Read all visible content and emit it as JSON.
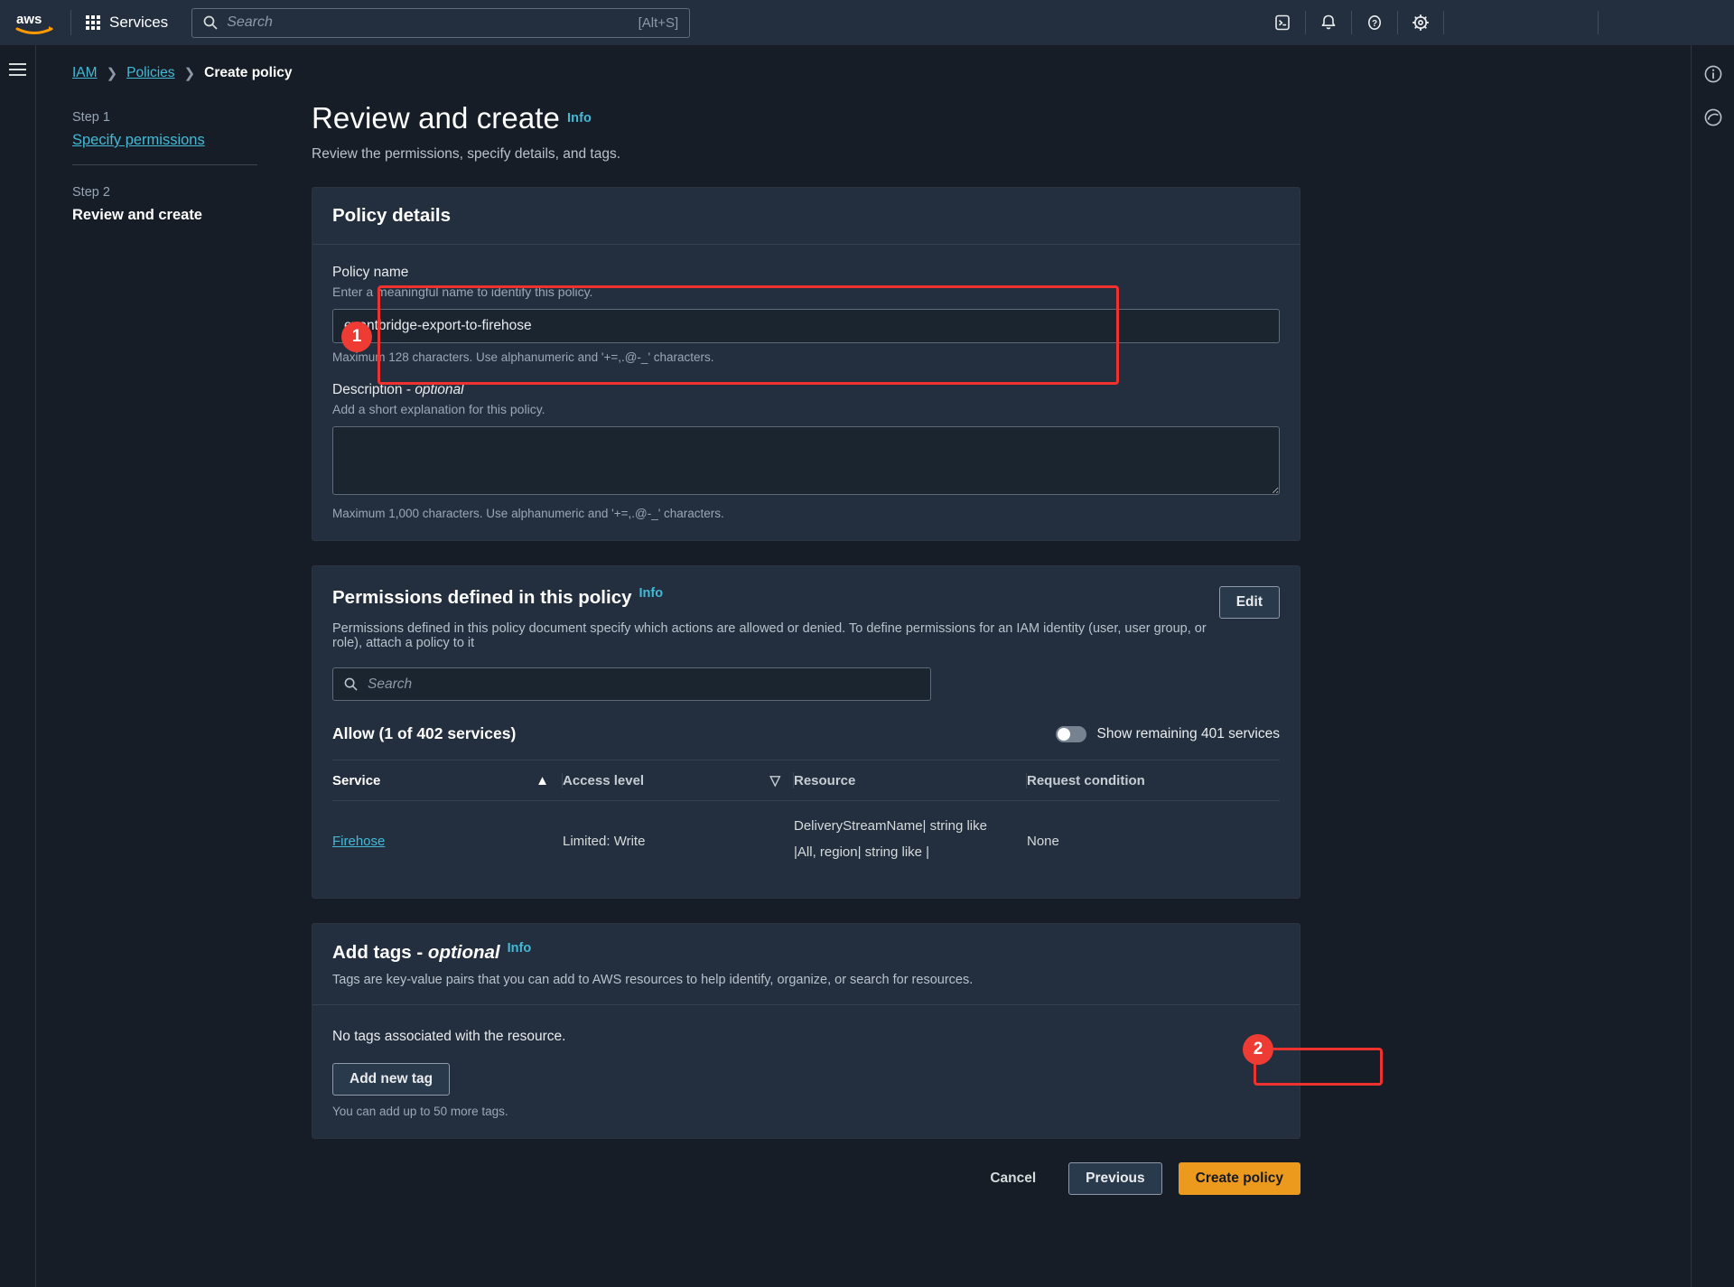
{
  "topnav": {
    "logo_alt": "aws",
    "services_label": "Services",
    "search_placeholder": "Search",
    "search_shortcut": "[Alt+S]",
    "icons": [
      "cloudshell-icon",
      "notifications-bell-icon",
      "help-circle-icon",
      "settings-gear-icon"
    ]
  },
  "breadcrumb": {
    "items": [
      "IAM",
      "Policies",
      "Create policy"
    ]
  },
  "steps": [
    {
      "number": "Step 1",
      "label": "Specify permissions",
      "current": false
    },
    {
      "number": "Step 2",
      "label": "Review and create",
      "current": true
    }
  ],
  "page": {
    "title": "Review and create",
    "info": "Info",
    "subtitle": "Review the permissions, specify details, and tags."
  },
  "policy_details": {
    "heading": "Policy details",
    "name_label": "Policy name",
    "name_desc": "Enter a meaningful name to identify this policy.",
    "name_value": "eventbridge-export-to-firehose",
    "name_hint": "Maximum 128 characters. Use alphanumeric and '+=,.@-_' characters.",
    "desc_label": "Description - ",
    "desc_label_em": "optional",
    "desc_desc": "Add a short explanation for this policy.",
    "desc_value": "",
    "desc_hint": "Maximum 1,000 characters. Use alphanumeric and '+=,.@-_' characters."
  },
  "permissions": {
    "heading": "Permissions defined in this policy",
    "info": "Info",
    "edit_label": "Edit",
    "description": "Permissions defined in this policy document specify which actions are allowed or denied. To define permissions for an IAM identity (user, user group, or role), attach a policy to it",
    "search_placeholder": "Search",
    "allow_title": "Allow (1 of 402 services)",
    "toggle_label": "Show remaining 401 services",
    "toggle_on": false,
    "columns": [
      "Service",
      "Access level",
      "Resource",
      "Request condition"
    ],
    "sort_column": "Service",
    "sort_glyph": "▲",
    "filter_glyph": "▽",
    "rows": [
      {
        "service": "Firehose",
        "access_level": "Limited: Write",
        "resource_line1": "DeliveryStreamName| string like",
        "resource_line2": "|All, region| string like |",
        "request_condition": "None"
      }
    ]
  },
  "tags": {
    "heading": "Add tags - ",
    "heading_em": "optional",
    "info": "Info",
    "description": "Tags are key-value pairs that you can add to AWS resources to help identify, organize, or search for resources.",
    "empty_note": "No tags associated with the resource.",
    "add_button": "Add new tag",
    "limit_hint": "You can add up to 50 more tags."
  },
  "footer": {
    "cancel": "Cancel",
    "previous": "Previous",
    "create": "Create policy"
  },
  "annotations": [
    {
      "id": "1",
      "target": "policy-name-field"
    },
    {
      "id": "2",
      "target": "create-policy-button"
    }
  ],
  "colors": {
    "accent_orange": "#ec9a1e",
    "link_blue": "#44b9d6",
    "annotation_red": "#ee3b33"
  }
}
